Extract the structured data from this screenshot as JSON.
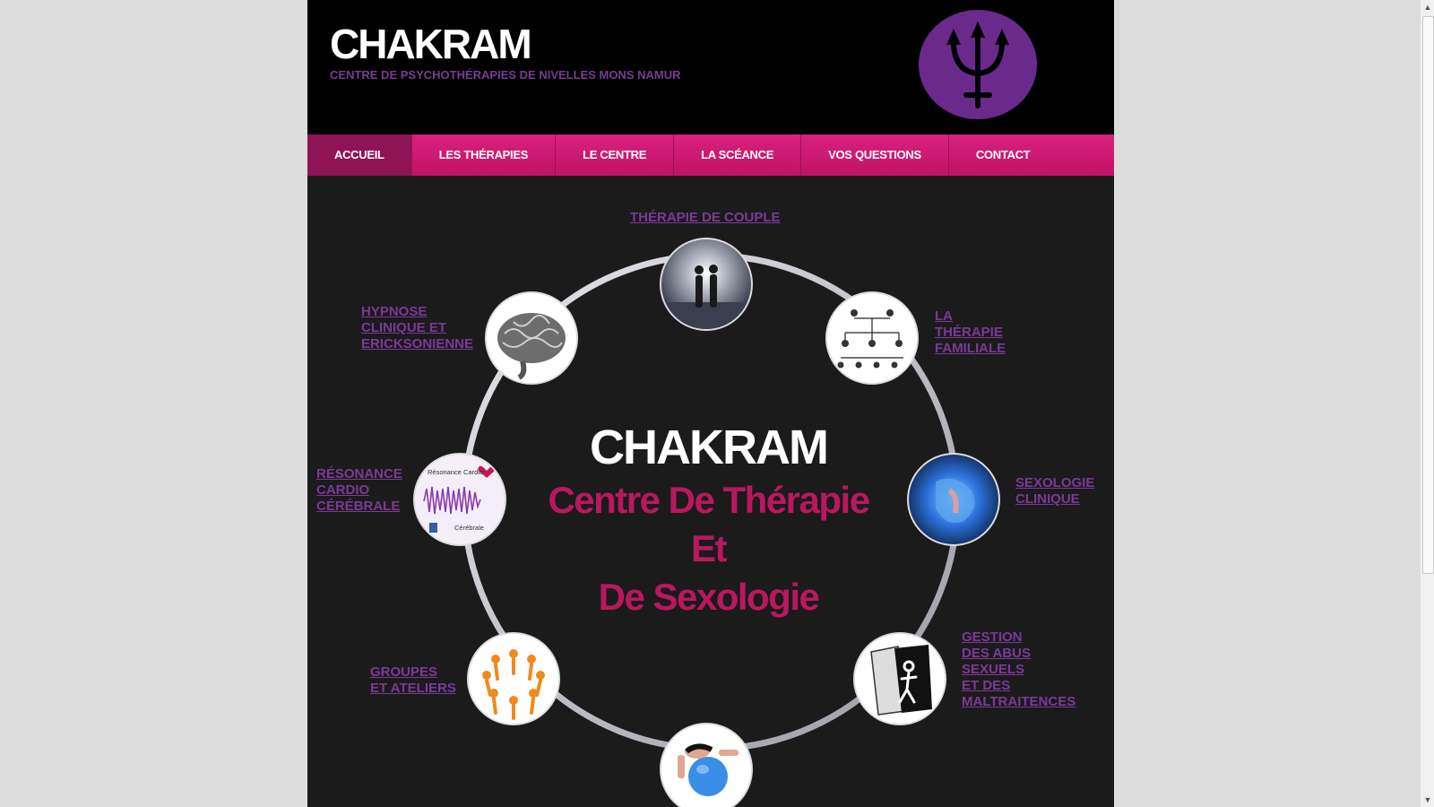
{
  "header": {
    "title": "CHAKRAM",
    "subtitle": "CENTRE DE PSYCHOTHÉRAPIES DE NIVELLES MONS NAMUR"
  },
  "colors": {
    "accent": "#c01367",
    "purple": "#7a3a96",
    "magenta_text": "#b9185f"
  },
  "nav": {
    "items": [
      "ACCUEIL",
      "LES THÉRAPIES",
      "LE CENTRE",
      "LA SCÉANCE",
      "VOS QUESTIONS",
      "CONTACT"
    ],
    "active": "ACCUEIL"
  },
  "main": {
    "center_title": "CHAKRAM",
    "center_line1": "Centre De Thérapie",
    "center_line2": "Et",
    "center_line3": "De Sexologie",
    "therapies": {
      "couple": "THÉRAPIE DE COUPLE",
      "familiale_1": "LA",
      "familiale_2": "THÉRAPIE",
      "familiale_3": "FAMILIALE",
      "hypnose_1": "HYPNOSE",
      "hypnose_2": "CLINIQUE ET",
      "hypnose_3": "ERICKSONIENNE",
      "resonance_1": "RÉSONANCE",
      "resonance_2": "CARDIO",
      "resonance_3": "CÉRÉBRALE",
      "sexologie_1": "SEXOLOGIE",
      "sexologie_2": "CLINIQUE",
      "groupes_1": "GROUPES",
      "groupes_2": "ET ATELIERS",
      "abus_1": "GESTION",
      "abus_2": "DES ABUS",
      "abus_3": "SEXUELS",
      "abus_4": "ET DES",
      "abus_5": "MALTRAITENCES"
    },
    "resonance_image_top": "Résonance Cardio",
    "resonance_image_bottom": "Cérébrale"
  }
}
